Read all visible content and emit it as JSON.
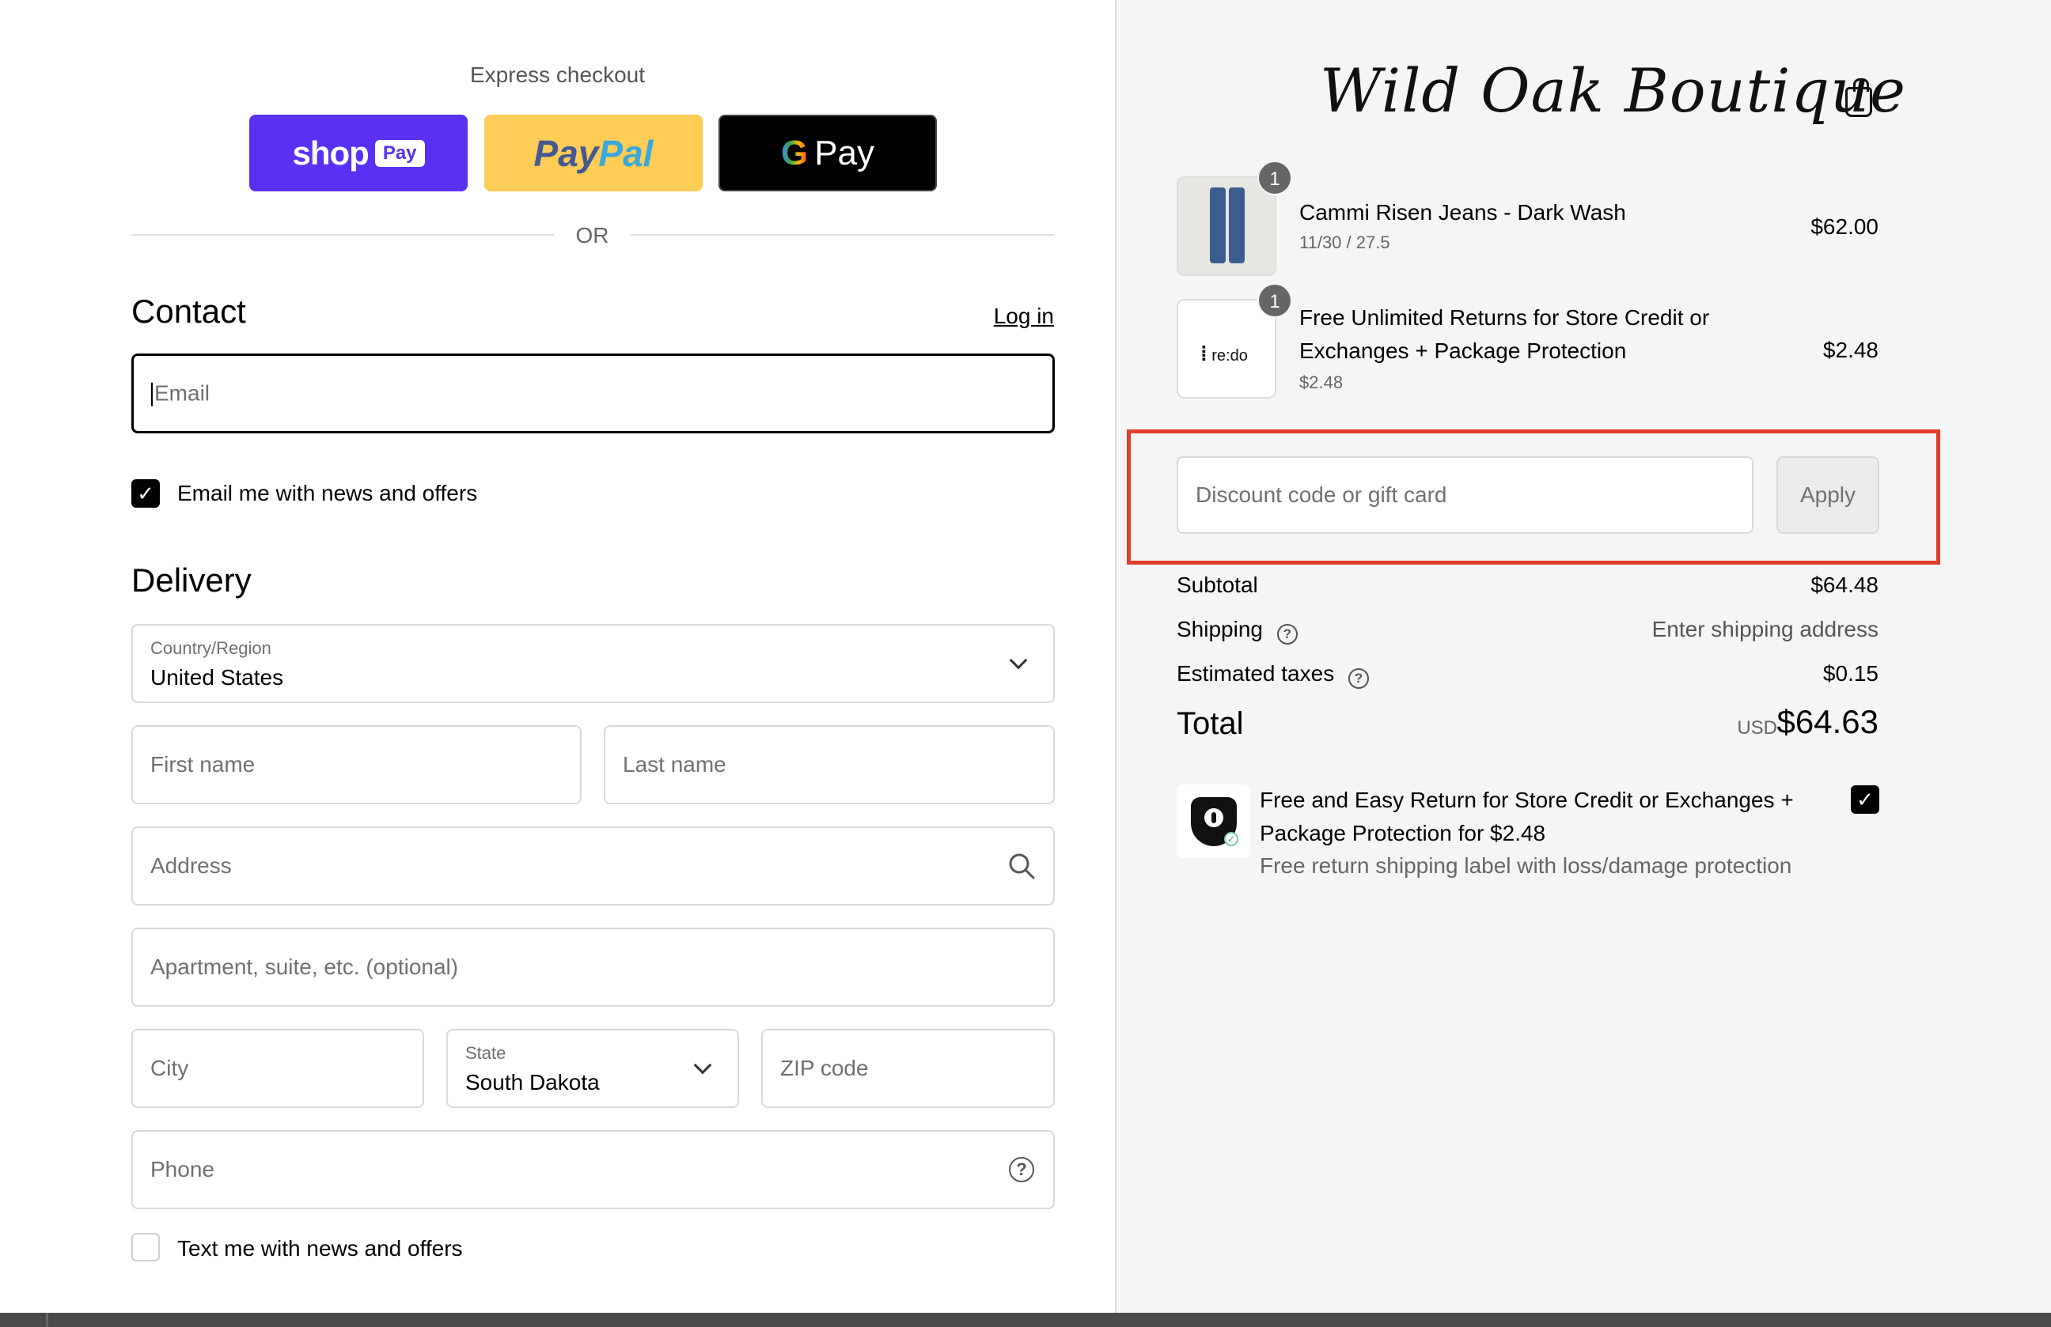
{
  "express": {
    "title": "Express checkout",
    "shop_pay": {
      "word": "shop",
      "pill": "Pay"
    },
    "paypal": {
      "part1": "Pay",
      "part2": "Pal"
    },
    "gpay": {
      "g": "G",
      "word": "Pay"
    },
    "divider": "OR"
  },
  "contact": {
    "title": "Contact",
    "login": "Log in",
    "email_placeholder": "Email",
    "news_checkbox_label": "Email me with news and offers",
    "news_checked": true
  },
  "delivery": {
    "title": "Delivery",
    "country_label": "Country/Region",
    "country_value": "United States",
    "first_name_placeholder": "First name",
    "last_name_placeholder": "Last name",
    "address_placeholder": "Address",
    "apartment_placeholder": "Apartment, suite, etc. (optional)",
    "city_placeholder": "City",
    "state_label": "State",
    "state_value": "South Dakota",
    "zip_placeholder": "ZIP code",
    "phone_placeholder": "Phone",
    "text_checkbox_label": "Text me with news and offers",
    "text_checked": false
  },
  "store": {
    "brand": "Wild Oak Boutique",
    "icons": {
      "cart": "shopping-bag-icon"
    }
  },
  "cart": {
    "items": [
      {
        "qty": "1",
        "name": "Cammi Risen Jeans - Dark Wash",
        "variant": "11/30 / 27.5",
        "price": "$62.00"
      },
      {
        "qty": "1",
        "name_line1": "Free Unlimited Returns for Store Credit or",
        "name_line2": "Exchanges + Package Protection",
        "variant": "$2.48",
        "price": "$2.48",
        "logo_text": "re:do"
      }
    ],
    "discount_placeholder": "Discount code or gift card",
    "apply_label": "Apply",
    "subtotal_label": "Subtotal",
    "subtotal_value": "$64.48",
    "shipping_label": "Shipping",
    "shipping_value": "Enter shipping address",
    "taxes_label": "Estimated taxes",
    "taxes_value": "$0.15",
    "total_label": "Total",
    "total_currency": "USD",
    "total_value": "$64.63",
    "protection": {
      "line1": "Free and Easy Return for Store Credit or Exchanges +",
      "line2": "Package Protection for $2.48",
      "sub": "Free return shipping label with loss/damage protection",
      "checked": true
    }
  },
  "colors": {
    "shop_pay": "#5a31f4",
    "paypal": "#ffc439",
    "highlight": "#e0402a",
    "right_bg": "#f5f5f5"
  }
}
